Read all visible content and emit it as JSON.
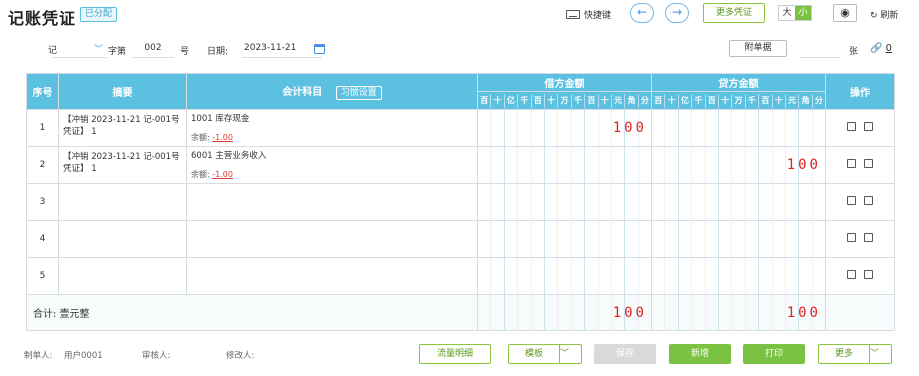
{
  "header": {
    "title": "记账凭证",
    "status_badge": "已分配",
    "shortcut_label": "快捷键",
    "prev_icon": "arrow-left-icon",
    "next_icon": "arrow-right-icon",
    "more_voucher_label": "更多凭证",
    "size_large": "大",
    "size_small": "小",
    "refresh_label": "刷新"
  },
  "voucher": {
    "word_type": "记",
    "word_label": "字第",
    "number": "002",
    "number_suffix": "号",
    "date_label": "日期:",
    "date_value": "2023-11-21",
    "attachments_label": "附单据",
    "attachments_unit": "张",
    "attachments_link_count": "0"
  },
  "table": {
    "headers": {
      "index": "序号",
      "summary": "摘要",
      "account": "会计科目",
      "habit_button": "习惯设置",
      "debit": "借方金额",
      "credit": "贷方金额",
      "actions": "操作"
    },
    "digit_units": [
      "百",
      "十",
      "亿",
      "千",
      "百",
      "十",
      "万",
      "千",
      "百",
      "十",
      "元",
      "角",
      "分"
    ],
    "rows": [
      {
        "index": "1",
        "summary": "【冲销 2023-11-21 记-001号凭证】 1",
        "account": "1001 库存现金",
        "balance_label": "余额:",
        "balance_value": "-1.00",
        "debit": "100",
        "credit": ""
      },
      {
        "index": "2",
        "summary": "【冲销 2023-11-21 记-001号凭证】 1",
        "account": "6001 主营业务收入",
        "balance_label": "余额:",
        "balance_value": "-1.00",
        "debit": "",
        "credit": "100"
      },
      {
        "index": "3",
        "summary": "",
        "account": "",
        "balance_label": "",
        "balance_value": "",
        "debit": "",
        "credit": ""
      },
      {
        "index": "4",
        "summary": "",
        "account": "",
        "balance_label": "",
        "balance_value": "",
        "debit": "",
        "credit": ""
      },
      {
        "index": "5",
        "summary": "",
        "account": "",
        "balance_label": "",
        "balance_value": "",
        "debit": "",
        "credit": ""
      }
    ],
    "total": {
      "label": "合计:  壹元整",
      "debit": "100",
      "credit": "100"
    }
  },
  "footer": {
    "maker_label": "制单人:",
    "maker_value": "用户0001",
    "auditor_label": "审核人:",
    "modifier_label": "修改人:",
    "flow_detail_button": "流量明细",
    "template_button": "模板",
    "save_button": "保存",
    "new_button": "新增",
    "print_button": "打印",
    "more_button": "更多"
  },
  "colors": {
    "header_bg": "#5cc0e0",
    "accent_green": "#7cc242",
    "amount_red": "#e02222"
  }
}
